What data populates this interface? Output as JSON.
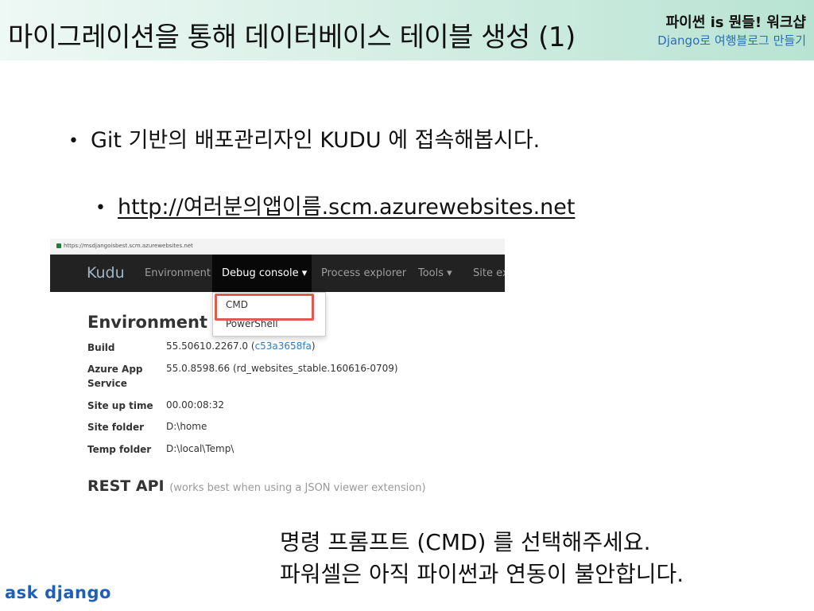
{
  "header": {
    "title": "마이그레이션을 통해 데이터베이스 테이블 생성 (1)",
    "workshop_title": "파이썬 is 뭔들! 워크샵",
    "workshop_subtitle": "Django로 여행블로그 만들기"
  },
  "bullets": {
    "main": "Git 기반의 배포관리자인 KUDU 에 접속해봅시다.",
    "sub_url": "http://여러분의앱이름.scm.azurewebsites.net"
  },
  "screenshot": {
    "address": "https://msdjangoisbest.scm.azurewebsites.net",
    "brand": "Kudu",
    "nav": {
      "environment": "Environment",
      "debug_console": "Debug console ▾",
      "process_explorer": "Process explorer",
      "tools": "Tools ▾",
      "site_ex": "Site ex"
    },
    "dropdown": {
      "cmd": "CMD",
      "powershell": "PowerShell"
    },
    "env_heading": "Environment",
    "info": {
      "build_label": "Build",
      "build_value": "55.50610.2267.0 (",
      "build_hash": "c53a3658fa",
      "build_close": ")",
      "azure_label": "Azure App Service",
      "azure_value": "55.0.8598.66 (rd_websites_stable.160616-0709)",
      "uptime_label": "Site up time",
      "uptime_value": "00.00:08:32",
      "folder_label": "Site folder",
      "folder_value": "D:\\home",
      "temp_label": "Temp folder",
      "temp_value": "D:\\local\\Temp\\"
    },
    "rest_heading": "REST API",
    "rest_sub": "(works best when using a JSON viewer extension)"
  },
  "notes": {
    "line1": "명령 프롬프트 (CMD) 를 선택해주세요.",
    "line2": "파워셀은 아직 파이썬과 연동이 불안합니다."
  },
  "logo": {
    "ask": "ask",
    "django": "django"
  },
  "colors": {
    "accent_link": "#337ab7",
    "highlight_border": "#e05a4f",
    "logo_blue": "#1f5fb8",
    "navbar_bg": "#222222"
  }
}
